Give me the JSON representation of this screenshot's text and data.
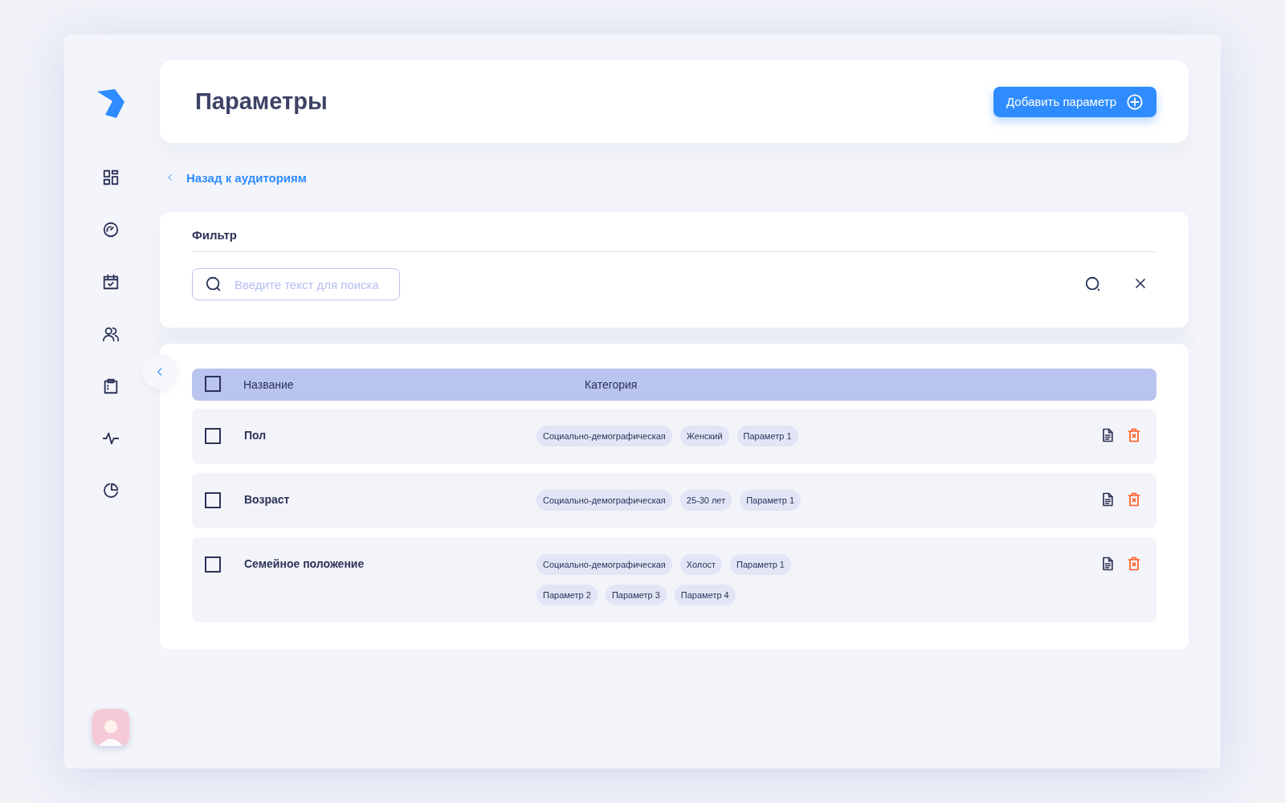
{
  "header": {
    "title": "Параметры",
    "add_button": "Добавить параметр"
  },
  "back_link": "Назад к аудиториям",
  "filter": {
    "title": "Фильтр",
    "search": {
      "placeholder": "Введите текст для поиска"
    }
  },
  "table": {
    "select_all": {
      "checked": false
    },
    "columns": [
      "Название",
      "Категория"
    ],
    "rows": [
      {
        "name": "Пол",
        "checked": false,
        "tags": [
          "Социально-демографическая",
          "Женский",
          "Параметр 1"
        ]
      },
      {
        "name": "Возраст",
        "checked": false,
        "tags": [
          "Социально-демографическая",
          "25-30 лет",
          "Параметр 1"
        ]
      },
      {
        "name": "Семейное положение",
        "checked": false,
        "tags": [
          "Социально-демографическая",
          "Холост",
          "Параметр 1",
          "Параметр 2",
          "Параметр 3",
          "Параметр 4"
        ]
      }
    ]
  }
}
